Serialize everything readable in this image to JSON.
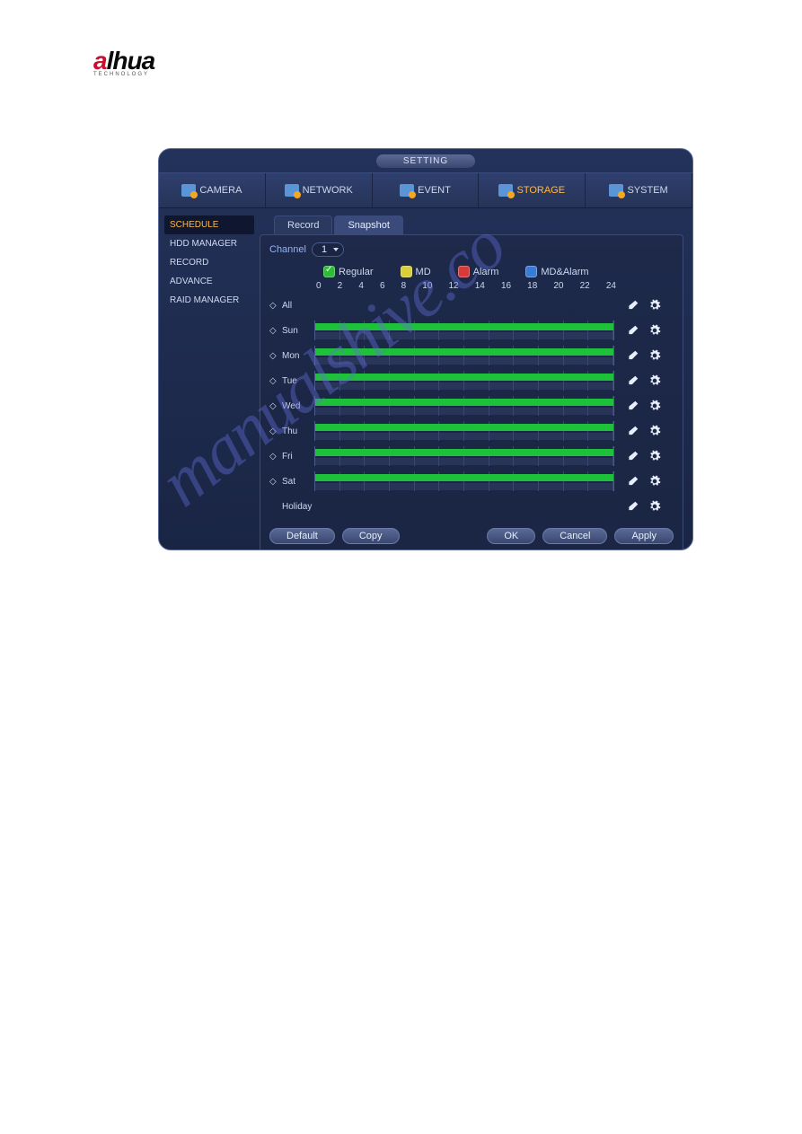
{
  "logo": {
    "part1": "a",
    "part2": "lhua",
    "sub": "TECHNOLOGY"
  },
  "title": "SETTING",
  "topnav": [
    {
      "label": "CAMERA"
    },
    {
      "label": "NETWORK"
    },
    {
      "label": "EVENT"
    },
    {
      "label": "STORAGE"
    },
    {
      "label": "SYSTEM"
    }
  ],
  "sidebar": [
    {
      "label": "SCHEDULE"
    },
    {
      "label": "HDD MANAGER"
    },
    {
      "label": "RECORD"
    },
    {
      "label": "ADVANCE"
    },
    {
      "label": "RAID MANAGER"
    }
  ],
  "tabs": [
    {
      "label": "Record"
    },
    {
      "label": "Snapshot"
    }
  ],
  "channel": {
    "label": "Channel",
    "value": "1"
  },
  "legend": [
    {
      "label": "Regular",
      "color": "green"
    },
    {
      "label": "MD",
      "color": "yellow"
    },
    {
      "label": "Alarm",
      "color": "red"
    },
    {
      "label": "MD&Alarm",
      "color": "blue"
    }
  ],
  "timeaxis": [
    "0",
    "2",
    "4",
    "6",
    "8",
    "10",
    "12",
    "14",
    "16",
    "18",
    "20",
    "22",
    "24"
  ],
  "days": [
    {
      "label": "All",
      "bar": false
    },
    {
      "label": "Sun",
      "bar": true
    },
    {
      "label": "Mon",
      "bar": true
    },
    {
      "label": "Tue",
      "bar": true
    },
    {
      "label": "Wed",
      "bar": true
    },
    {
      "label": "Thu",
      "bar": true
    },
    {
      "label": "Fri",
      "bar": true
    },
    {
      "label": "Sat",
      "bar": true
    },
    {
      "label": "Holiday",
      "bar": false
    }
  ],
  "buttons": {
    "default": "Default",
    "copy": "Copy",
    "ok": "OK",
    "cancel": "Cancel",
    "apply": "Apply"
  },
  "watermark": "manualshive.co"
}
